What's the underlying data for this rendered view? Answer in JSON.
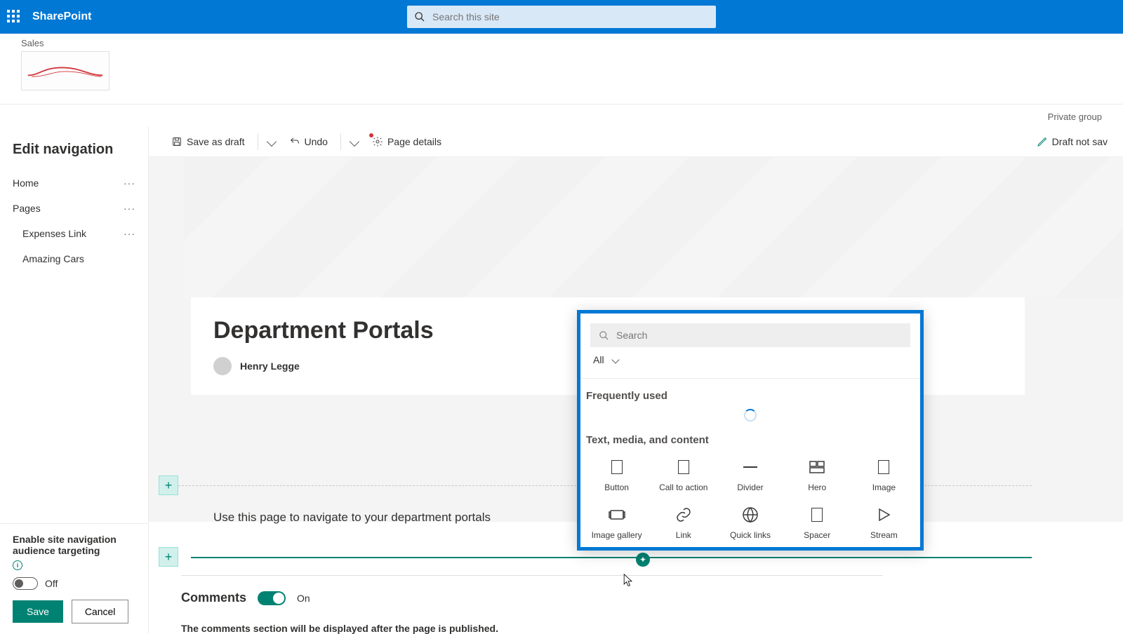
{
  "header": {
    "app": "SharePoint",
    "search_placeholder": "Search this site"
  },
  "site": {
    "title": "Sales",
    "group_label": "Private group"
  },
  "leftnav": {
    "heading": "Edit navigation",
    "items": [
      {
        "label": "Home"
      },
      {
        "label": "Pages"
      },
      {
        "label": "Expenses Link"
      },
      {
        "label": "Amazing Cars"
      }
    ],
    "aud_label": "Enable site navigation audience targeting",
    "toggle_off_label": "Off",
    "save": "Save",
    "cancel": "Cancel"
  },
  "cmdbar": {
    "save_draft": "Save as draft",
    "undo": "Undo",
    "page_details": "Page details",
    "draft_status": "Draft not sav"
  },
  "page": {
    "title": "Department Portals",
    "author": "Henry Legge",
    "desc": "Use this page to navigate to your department portals",
    "comments_heading": "Comments",
    "comments_on": "On",
    "comments_note": "The comments section will be displayed after the page is published."
  },
  "picker": {
    "search_placeholder": "Search",
    "filter": "All",
    "freq_label": "Frequently used",
    "text_label": "Text, media, and content",
    "items_row1": [
      "Button",
      "Call to action",
      "Divider",
      "Hero",
      "Image"
    ],
    "items_row2": [
      "Image gallery",
      "Link",
      "Quick links",
      "Spacer",
      "Stream"
    ]
  }
}
